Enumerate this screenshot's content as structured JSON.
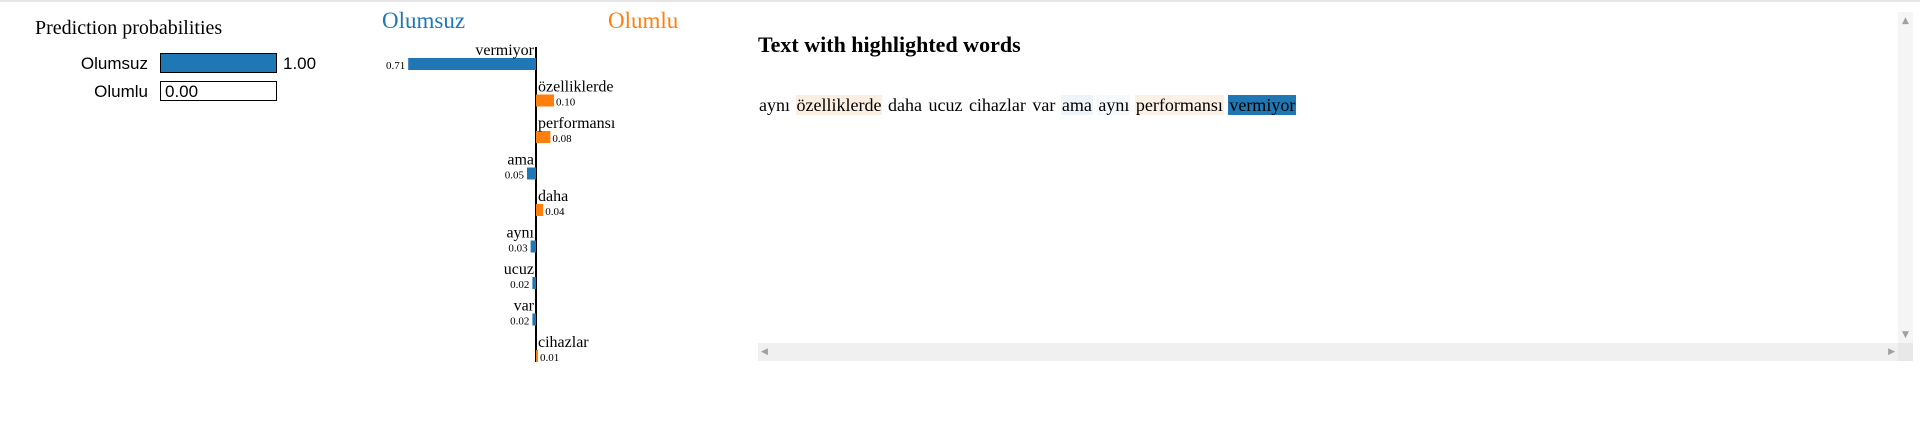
{
  "prediction": {
    "title": "Prediction probabilities",
    "items": [
      {
        "label": "Olumsuz",
        "value": 1.0,
        "value_text": "1.00",
        "color": "#1f77b4"
      },
      {
        "label": "Olumlu",
        "value": 0.0,
        "value_text": "0.00",
        "color": "#ff7f0e"
      }
    ]
  },
  "explanation": {
    "neg_label": "Olumsuz",
    "pos_label": "Olumlu",
    "neg_color": "#1f77b4",
    "pos_color": "#ff7f0e",
    "features": [
      {
        "word": "vermiyor",
        "weight": 0.71,
        "weight_text": "0.71",
        "side": "neg"
      },
      {
        "word": "özelliklerde",
        "weight": 0.1,
        "weight_text": "0.10",
        "side": "pos"
      },
      {
        "word": "performansı",
        "weight": 0.08,
        "weight_text": "0.08",
        "side": "pos"
      },
      {
        "word": "ama",
        "weight": 0.05,
        "weight_text": "0.05",
        "side": "neg"
      },
      {
        "word": "daha",
        "weight": 0.04,
        "weight_text": "0.04",
        "side": "pos"
      },
      {
        "word": "aynı",
        "weight": 0.03,
        "weight_text": "0.03",
        "side": "neg"
      },
      {
        "word": "ucuz",
        "weight": 0.02,
        "weight_text": "0.02",
        "side": "neg"
      },
      {
        "word": "var",
        "weight": 0.02,
        "weight_text": "0.02",
        "side": "neg"
      },
      {
        "word": "cihazlar",
        "weight": 0.01,
        "weight_text": "0.01",
        "side": "pos"
      }
    ]
  },
  "text_panel": {
    "title": "Text with highlighted words",
    "tokens": [
      {
        "text": "aynı",
        "bg": ""
      },
      {
        "text": "özelliklerde",
        "bg": "#fdeee2"
      },
      {
        "text": "daha",
        "bg": ""
      },
      {
        "text": "ucuz",
        "bg": ""
      },
      {
        "text": "cihazlar",
        "bg": ""
      },
      {
        "text": "var",
        "bg": ""
      },
      {
        "text": "ama",
        "bg": "#eef4fa"
      },
      {
        "text": "aynı",
        "bg": "#f6f9fc"
      },
      {
        "text": "performansı",
        "bg": "#fdf0e5"
      },
      {
        "text": "vermiyor",
        "bg": "#1f77b4"
      }
    ]
  }
}
